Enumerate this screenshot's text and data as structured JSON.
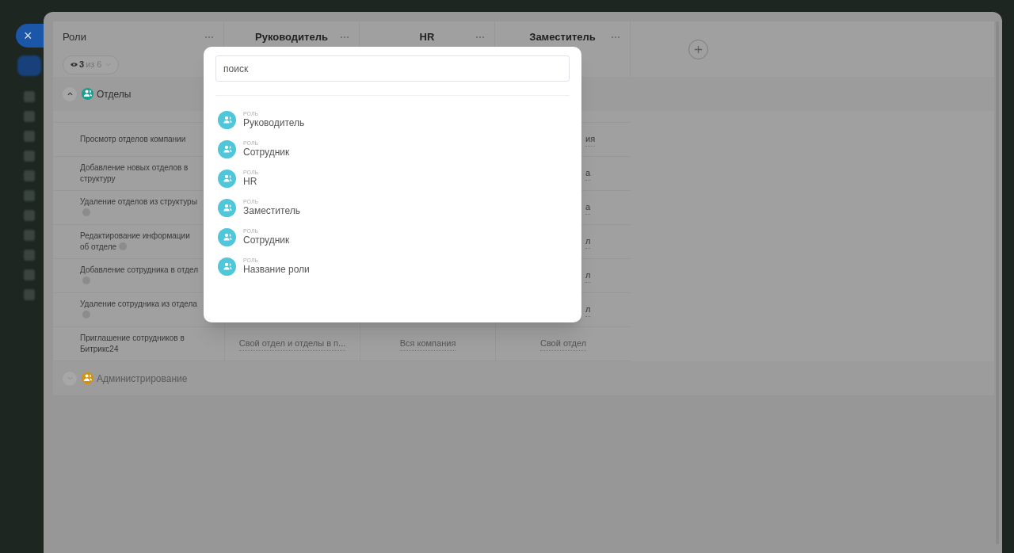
{
  "close_button": "×",
  "table": {
    "columns": [
      {
        "title": "Роли"
      },
      {
        "title": "Руководитель"
      },
      {
        "title": "HR"
      },
      {
        "title": "Заместитель"
      }
    ],
    "visible_filter": {
      "count": "3",
      "of": "из 6"
    },
    "sections": [
      {
        "title": "Отделы",
        "expanded": true,
        "color": "#16a090",
        "rows": [
          {
            "label": "Просмотр отделов компании",
            "help": false,
            "partial_cell": "ия"
          },
          {
            "label": "Добавление новых отделов в структуру",
            "help": false,
            "partial_cell": "а"
          },
          {
            "label": "Удаление отделов из структуры",
            "help": true,
            "partial_cell": "а"
          },
          {
            "label": "Редактирование информации об отделе",
            "help": true,
            "partial_cell": "л"
          },
          {
            "label": "Добавление сотрудника в отдел",
            "help": true,
            "partial_cell": "л"
          },
          {
            "label": "Удаление сотрудника из отдела",
            "help": true,
            "partial_cell": "л"
          },
          {
            "label": "Приглашение сотрудников в Битрикс24",
            "help": false,
            "cells": [
              "Свой отдел и отделы в п...",
              "Вся компания",
              "Свой отдел"
            ]
          }
        ]
      },
      {
        "title": "Администрирование",
        "expanded": false,
        "color": "#d4920c"
      }
    ]
  },
  "popup": {
    "search": {
      "placeholder": "поиск"
    },
    "items": [
      {
        "caption": "РОЛЬ",
        "name": "Руководитель"
      },
      {
        "caption": "РОЛЬ",
        "name": "Сотрудник"
      },
      {
        "caption": "РОЛЬ",
        "name": "HR"
      },
      {
        "caption": "РОЛЬ",
        "name": "Заместитель"
      },
      {
        "caption": "РОЛЬ",
        "name": "Сотрудник"
      },
      {
        "caption": "РОЛЬ",
        "name": "Название роли"
      }
    ]
  }
}
